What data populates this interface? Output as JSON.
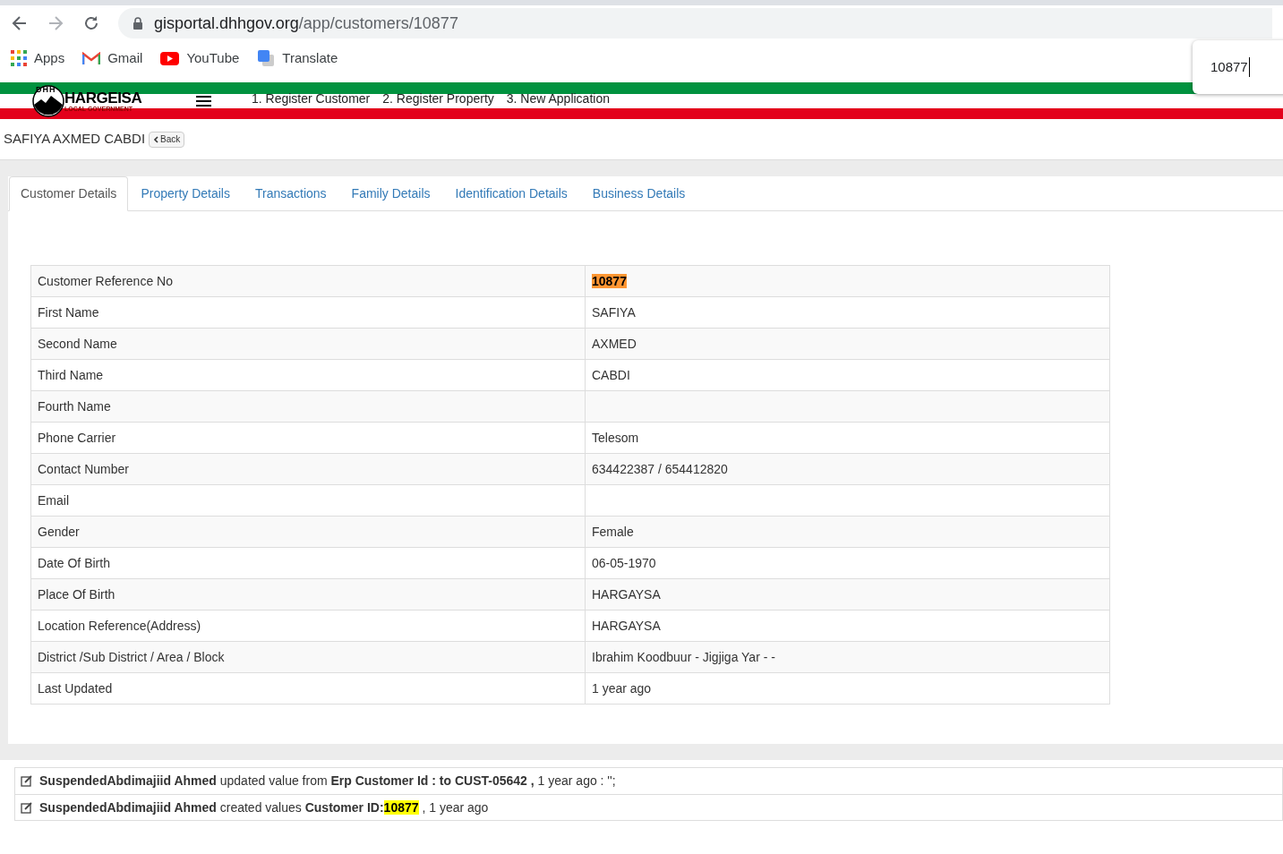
{
  "browser": {
    "url_host": "gisportal.dhhgov.org",
    "url_path": "/app/customers/10877",
    "bookmarks": [
      {
        "label": "Apps",
        "kind": "apps"
      },
      {
        "label": "Gmail",
        "kind": "gmail"
      },
      {
        "label": "YouTube",
        "kind": "youtube"
      },
      {
        "label": "Translate",
        "kind": "translate"
      }
    ],
    "find_box": {
      "value": "10877"
    }
  },
  "header": {
    "logo_title": "HARGEISA",
    "logo_subtitle": "LOCAL GOVERNMENT",
    "logo_initials": [
      "D",
      "H",
      "H"
    ],
    "nav": [
      "1. Register Customer",
      "2. Register Property",
      "3. New Application"
    ]
  },
  "customer_name": "SAFIYA AXMED CABDI",
  "back_button": "Back",
  "tabs": [
    {
      "label": "Customer Details",
      "selected": true
    },
    {
      "label": "Property Details",
      "selected": false
    },
    {
      "label": "Transactions",
      "selected": false
    },
    {
      "label": "Family Details",
      "selected": false
    },
    {
      "label": "Identification Details",
      "selected": false
    },
    {
      "label": "Business Details",
      "selected": false
    }
  ],
  "details": [
    {
      "label": "Customer Reference No",
      "value": "10877",
      "highlighted": true,
      "current_match": true
    },
    {
      "label": "First Name",
      "value": "SAFIYA"
    },
    {
      "label": "Second Name",
      "value": "AXMED"
    },
    {
      "label": "Third Name",
      "value": "CABDI"
    },
    {
      "label": "Fourth Name"
    },
    {
      "label": "Phone Carrier",
      "value": "Telesom"
    },
    {
      "label": "Contact Number",
      "value": "634422387 / 654412820"
    },
    {
      "label": "Email"
    },
    {
      "label": "Gender",
      "value": "Female"
    },
    {
      "label": "Date Of Birth",
      "value": "06-05-1970"
    },
    {
      "label": "Place Of Birth",
      "value": "HARGAYSA"
    },
    {
      "label": "Location Reference(Address)",
      "value": "HARGAYSA"
    },
    {
      "label": "District /Sub District / Area / Block",
      "value": "Ibrahim Koodbuur - Jigjiga Yar - -"
    },
    {
      "label": "Last Updated",
      "value": "1 year ago"
    }
  ],
  "log": [
    {
      "parts": [
        {
          "text": "SuspendedAbdimajiid Ahmed",
          "bold": true
        },
        {
          "text": " updated value from "
        },
        {
          "text": "Erp Customer Id : to CUST-05642 ,",
          "bold": true
        },
        {
          "text": " 1 year ago : '';"
        }
      ]
    },
    {
      "parts": [
        {
          "text": "SuspendedAbdimajiid Ahmed",
          "bold": true
        },
        {
          "text": " created values "
        },
        {
          "text": "Customer ID:",
          "bold": true
        },
        {
          "text": "10877",
          "bold": true,
          "highlighted": true,
          "current_match": false
        },
        {
          "text": " , 1 year ago"
        }
      ]
    }
  ]
}
